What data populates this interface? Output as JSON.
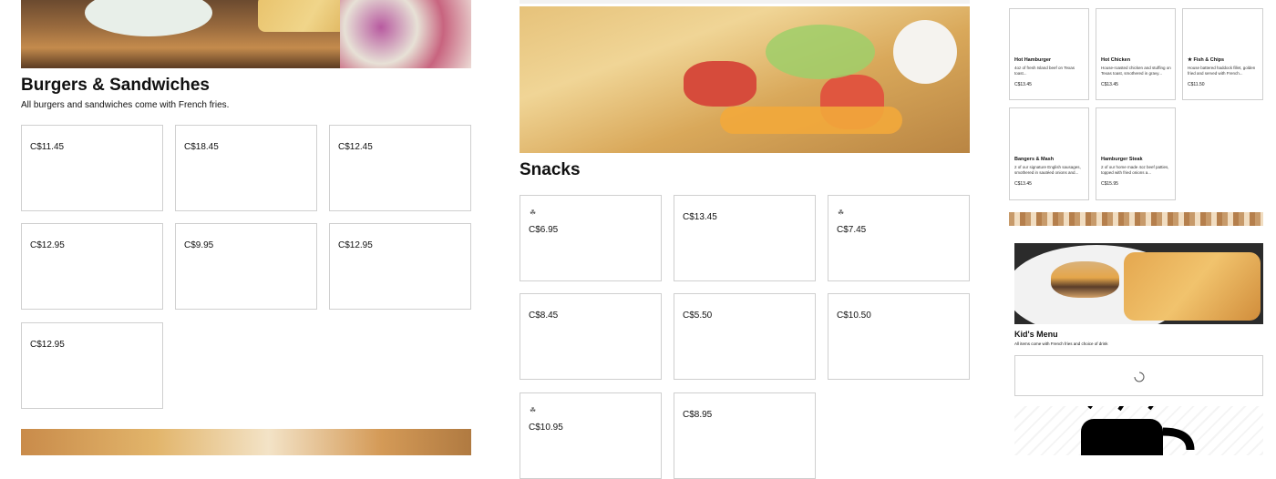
{
  "burgers": {
    "title": "Burgers & Sandwiches",
    "subtitle": "All burgers and sandwiches come with French fries.",
    "prices": [
      "C$11.45",
      "C$18.45",
      "C$12.45",
      "C$12.95",
      "C$9.95",
      "C$12.95",
      "C$12.95"
    ]
  },
  "snacks": {
    "title": "Snacks",
    "prices": [
      "C$6.95",
      "C$13.45",
      "C$7.45",
      "C$8.45",
      "C$5.50",
      "C$10.50",
      "C$10.95",
      "C$8.95"
    ],
    "leaf_icon": "leaf-icon"
  },
  "right_panel": {
    "items": [
      {
        "name": "Hot Hamburger",
        "desc": "4oz of fresh Island beef on Texas toast...",
        "price": "C$13.45"
      },
      {
        "name": "Hot Chicken",
        "desc": "House-roasted chicken and stuffing on Texas toast, smothered in gravy...",
        "price": "C$13.45"
      },
      {
        "name": "Fish & Chips",
        "desc": "House battered haddock fillet, golden fried and served with French...",
        "price": "C$11.50",
        "star": "★"
      },
      {
        "name": "Bangers & Mash",
        "desc": "2 of our signature English sausages, smothered in sautéed onions and...",
        "price": "C$13.45"
      },
      {
        "name": "Hamburger Steak",
        "desc": "2 of our home made 4oz beef patties, topped with fried onions a...",
        "price": "C$15.95"
      }
    ],
    "kids_title": "Kid's Menu",
    "kids_subtitle": "All items come with French fries and choice of drink"
  },
  "colors": {
    "border": "#cfcfcf",
    "text": "#111111",
    "bg": "#ffffff"
  }
}
